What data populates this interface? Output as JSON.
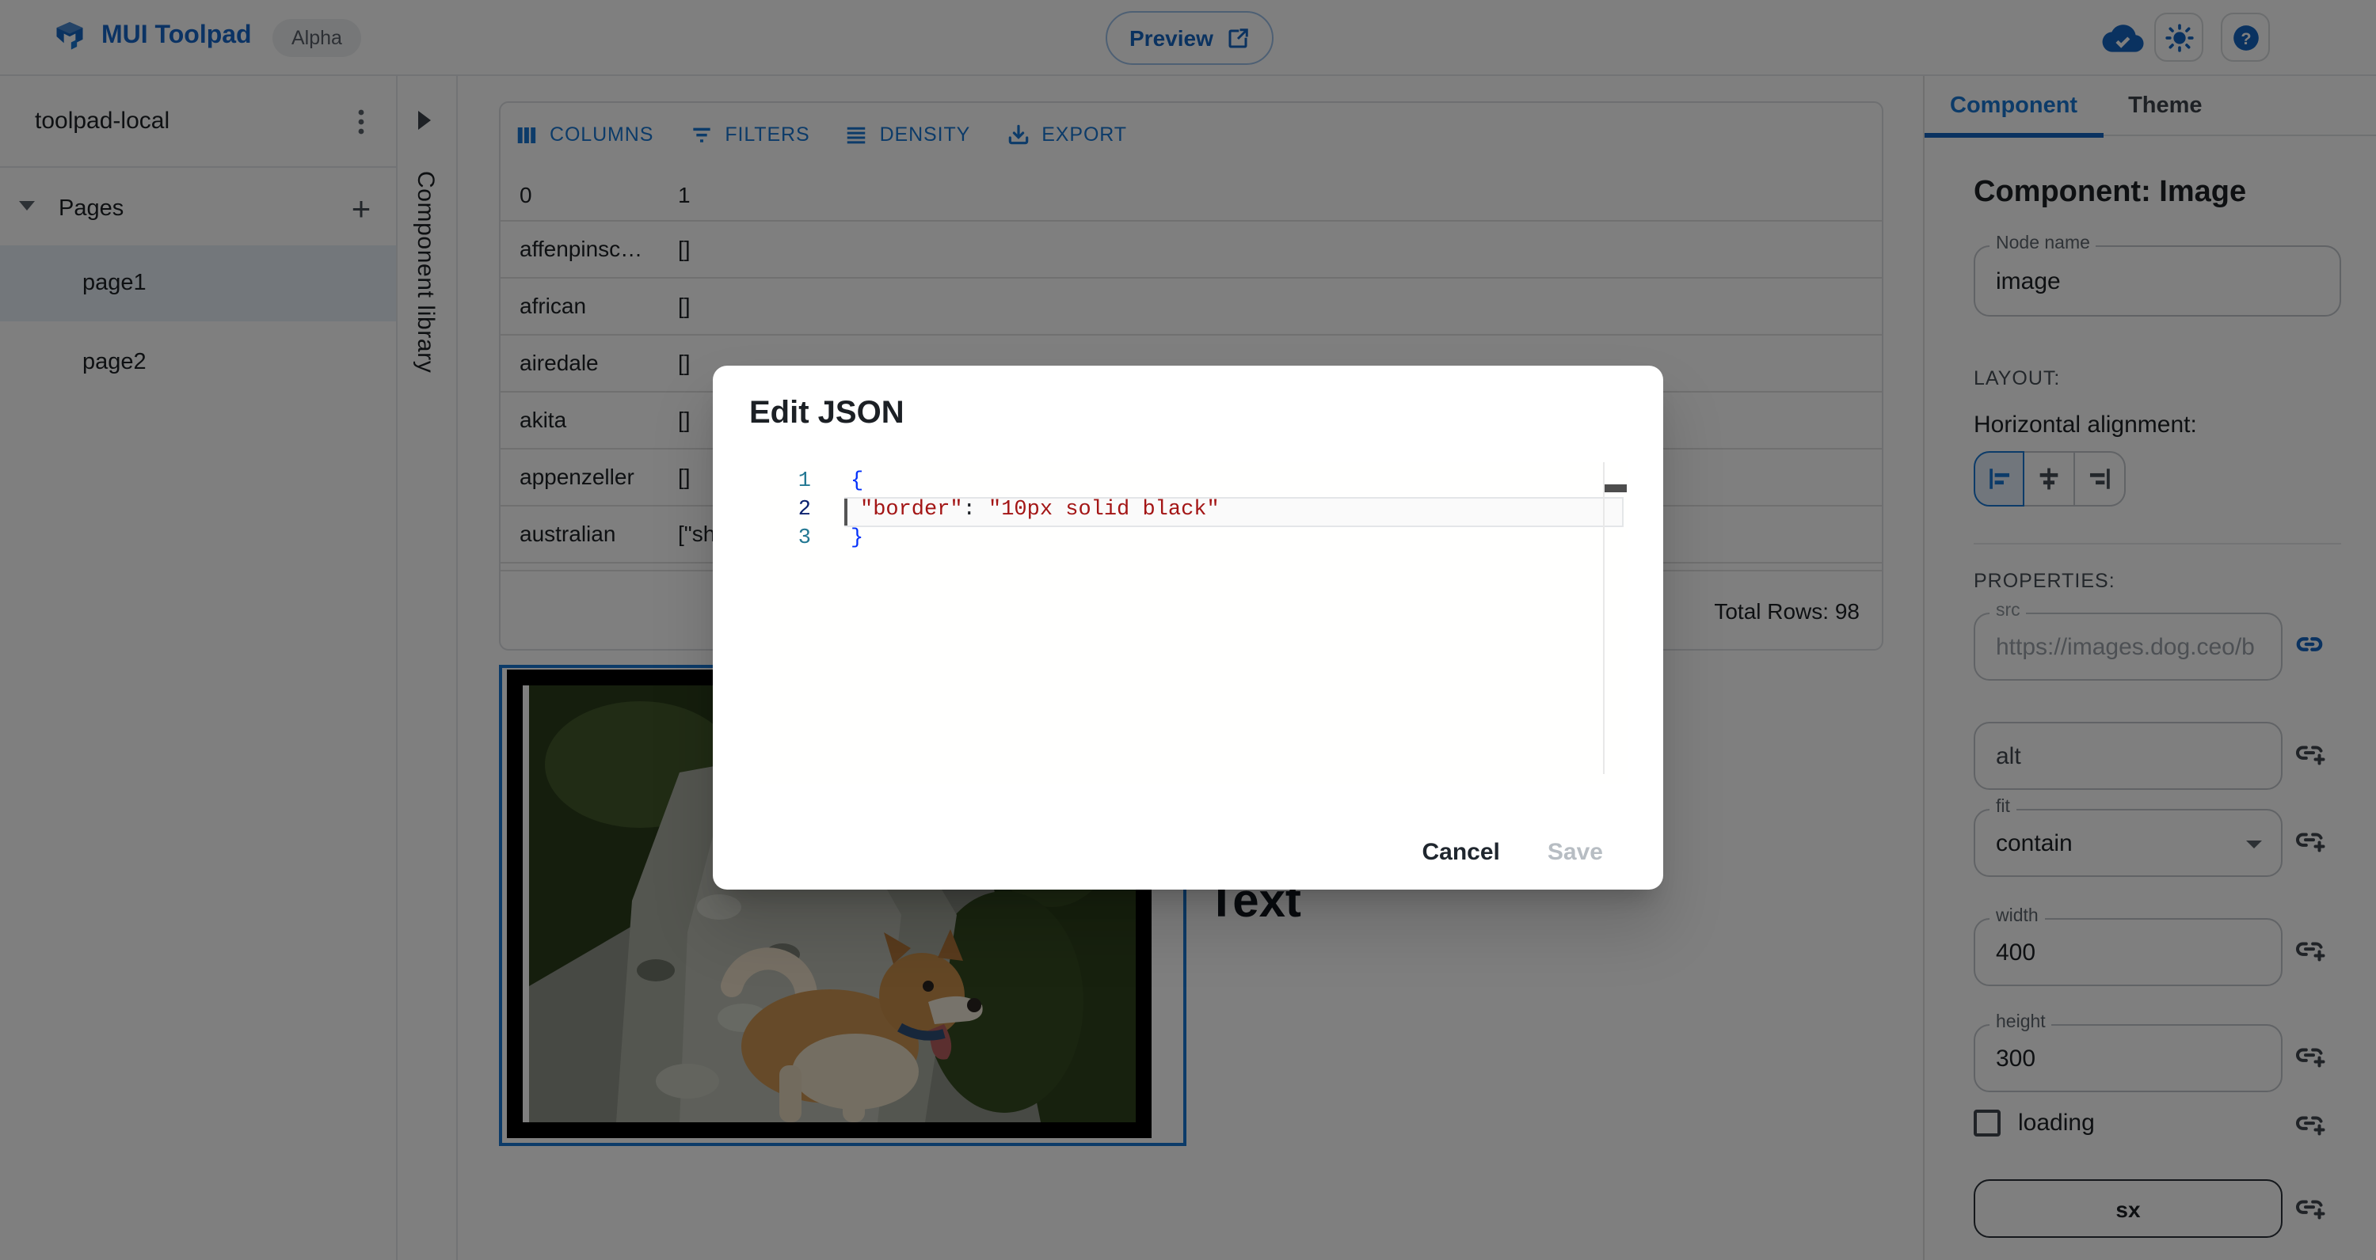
{
  "topbar": {
    "brand": "MUI Toolpad",
    "alpha_badge": "Alpha",
    "preview_label": "Preview"
  },
  "sidebar": {
    "project_name": "toolpad-local",
    "pages_header": "Pages",
    "pages": [
      {
        "name": "page1"
      },
      {
        "name": "page2"
      }
    ]
  },
  "library_rail": {
    "label": "Component library"
  },
  "grid": {
    "toolbar": [
      {
        "label": "COLUMNS"
      },
      {
        "label": "FILTERS"
      },
      {
        "label": "DENSITY"
      },
      {
        "label": "EXPORT"
      }
    ],
    "columns": [
      "0",
      "1"
    ],
    "rows": [
      [
        "affenpinsc…",
        "[]"
      ],
      [
        "african",
        "[]"
      ],
      [
        "airedale",
        "[]"
      ],
      [
        "akita",
        "[]"
      ],
      [
        "appenzeller",
        "[]"
      ],
      [
        "australian",
        "[\"sh"
      ]
    ],
    "footer_total": "Total Rows: 98"
  },
  "canvas": {
    "text_component_label": "Text"
  },
  "modal": {
    "title": "Edit JSON",
    "code": {
      "n1": "1",
      "n2": "2",
      "n3": "3",
      "l1": "{",
      "l2_key": "\"border\"",
      "l2_colon": ": ",
      "l2_value": "\"10px solid black\"",
      "l3": "}"
    },
    "cancel_label": "Cancel",
    "save_label": "Save"
  },
  "inspector": {
    "tabs": [
      {
        "label": "Component"
      },
      {
        "label": "Theme"
      }
    ],
    "heading": "Component: Image",
    "node_name": {
      "label": "Node name",
      "value": "image"
    },
    "layout_section": "LAYOUT:",
    "horizontal_alignment_label": "Horizontal alignment:",
    "properties_section": "PROPERTIES:",
    "fields": {
      "src": {
        "label": "src",
        "value": "https://images.dog.ceo/b"
      },
      "alt": {
        "label": "alt"
      },
      "fit": {
        "label": "fit",
        "value": "contain"
      },
      "width": {
        "label": "width",
        "value": "400"
      },
      "height": {
        "label": "height",
        "value": "300"
      },
      "loading": {
        "label": "loading"
      },
      "sx": {
        "label": "sx"
      }
    }
  },
  "colors": {
    "accent": "#1976d2",
    "backdrop": "rgba(0,0,0,0.5)",
    "code_string": "#a31515",
    "code_brace": "#0431fa",
    "line_number": "#237893",
    "active_line_number": "#0b216f",
    "selection_border": "#1976d2",
    "image_border": "#000000"
  }
}
